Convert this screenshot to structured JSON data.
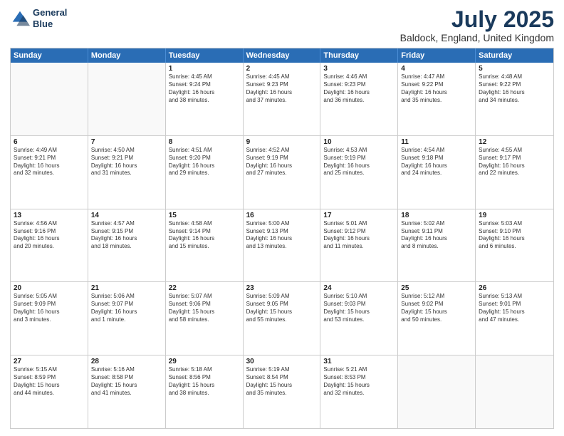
{
  "header": {
    "logo_line1": "General",
    "logo_line2": "Blue",
    "title": "July 2025",
    "subtitle": "Baldock, England, United Kingdom"
  },
  "weekdays": [
    "Sunday",
    "Monday",
    "Tuesday",
    "Wednesday",
    "Thursday",
    "Friday",
    "Saturday"
  ],
  "weeks": [
    [
      {
        "day": "",
        "text": ""
      },
      {
        "day": "",
        "text": ""
      },
      {
        "day": "1",
        "text": "Sunrise: 4:45 AM\nSunset: 9:24 PM\nDaylight: 16 hours\nand 38 minutes."
      },
      {
        "day": "2",
        "text": "Sunrise: 4:45 AM\nSunset: 9:23 PM\nDaylight: 16 hours\nand 37 minutes."
      },
      {
        "day": "3",
        "text": "Sunrise: 4:46 AM\nSunset: 9:23 PM\nDaylight: 16 hours\nand 36 minutes."
      },
      {
        "day": "4",
        "text": "Sunrise: 4:47 AM\nSunset: 9:22 PM\nDaylight: 16 hours\nand 35 minutes."
      },
      {
        "day": "5",
        "text": "Sunrise: 4:48 AM\nSunset: 9:22 PM\nDaylight: 16 hours\nand 34 minutes."
      }
    ],
    [
      {
        "day": "6",
        "text": "Sunrise: 4:49 AM\nSunset: 9:21 PM\nDaylight: 16 hours\nand 32 minutes."
      },
      {
        "day": "7",
        "text": "Sunrise: 4:50 AM\nSunset: 9:21 PM\nDaylight: 16 hours\nand 31 minutes."
      },
      {
        "day": "8",
        "text": "Sunrise: 4:51 AM\nSunset: 9:20 PM\nDaylight: 16 hours\nand 29 minutes."
      },
      {
        "day": "9",
        "text": "Sunrise: 4:52 AM\nSunset: 9:19 PM\nDaylight: 16 hours\nand 27 minutes."
      },
      {
        "day": "10",
        "text": "Sunrise: 4:53 AM\nSunset: 9:19 PM\nDaylight: 16 hours\nand 25 minutes."
      },
      {
        "day": "11",
        "text": "Sunrise: 4:54 AM\nSunset: 9:18 PM\nDaylight: 16 hours\nand 24 minutes."
      },
      {
        "day": "12",
        "text": "Sunrise: 4:55 AM\nSunset: 9:17 PM\nDaylight: 16 hours\nand 22 minutes."
      }
    ],
    [
      {
        "day": "13",
        "text": "Sunrise: 4:56 AM\nSunset: 9:16 PM\nDaylight: 16 hours\nand 20 minutes."
      },
      {
        "day": "14",
        "text": "Sunrise: 4:57 AM\nSunset: 9:15 PM\nDaylight: 16 hours\nand 18 minutes."
      },
      {
        "day": "15",
        "text": "Sunrise: 4:58 AM\nSunset: 9:14 PM\nDaylight: 16 hours\nand 15 minutes."
      },
      {
        "day": "16",
        "text": "Sunrise: 5:00 AM\nSunset: 9:13 PM\nDaylight: 16 hours\nand 13 minutes."
      },
      {
        "day": "17",
        "text": "Sunrise: 5:01 AM\nSunset: 9:12 PM\nDaylight: 16 hours\nand 11 minutes."
      },
      {
        "day": "18",
        "text": "Sunrise: 5:02 AM\nSunset: 9:11 PM\nDaylight: 16 hours\nand 8 minutes."
      },
      {
        "day": "19",
        "text": "Sunrise: 5:03 AM\nSunset: 9:10 PM\nDaylight: 16 hours\nand 6 minutes."
      }
    ],
    [
      {
        "day": "20",
        "text": "Sunrise: 5:05 AM\nSunset: 9:09 PM\nDaylight: 16 hours\nand 3 minutes."
      },
      {
        "day": "21",
        "text": "Sunrise: 5:06 AM\nSunset: 9:07 PM\nDaylight: 16 hours\nand 1 minute."
      },
      {
        "day": "22",
        "text": "Sunrise: 5:07 AM\nSunset: 9:06 PM\nDaylight: 15 hours\nand 58 minutes."
      },
      {
        "day": "23",
        "text": "Sunrise: 5:09 AM\nSunset: 9:05 PM\nDaylight: 15 hours\nand 55 minutes."
      },
      {
        "day": "24",
        "text": "Sunrise: 5:10 AM\nSunset: 9:03 PM\nDaylight: 15 hours\nand 53 minutes."
      },
      {
        "day": "25",
        "text": "Sunrise: 5:12 AM\nSunset: 9:02 PM\nDaylight: 15 hours\nand 50 minutes."
      },
      {
        "day": "26",
        "text": "Sunrise: 5:13 AM\nSunset: 9:01 PM\nDaylight: 15 hours\nand 47 minutes."
      }
    ],
    [
      {
        "day": "27",
        "text": "Sunrise: 5:15 AM\nSunset: 8:59 PM\nDaylight: 15 hours\nand 44 minutes."
      },
      {
        "day": "28",
        "text": "Sunrise: 5:16 AM\nSunset: 8:58 PM\nDaylight: 15 hours\nand 41 minutes."
      },
      {
        "day": "29",
        "text": "Sunrise: 5:18 AM\nSunset: 8:56 PM\nDaylight: 15 hours\nand 38 minutes."
      },
      {
        "day": "30",
        "text": "Sunrise: 5:19 AM\nSunset: 8:54 PM\nDaylight: 15 hours\nand 35 minutes."
      },
      {
        "day": "31",
        "text": "Sunrise: 5:21 AM\nSunset: 8:53 PM\nDaylight: 15 hours\nand 32 minutes."
      },
      {
        "day": "",
        "text": ""
      },
      {
        "day": "",
        "text": ""
      }
    ]
  ]
}
